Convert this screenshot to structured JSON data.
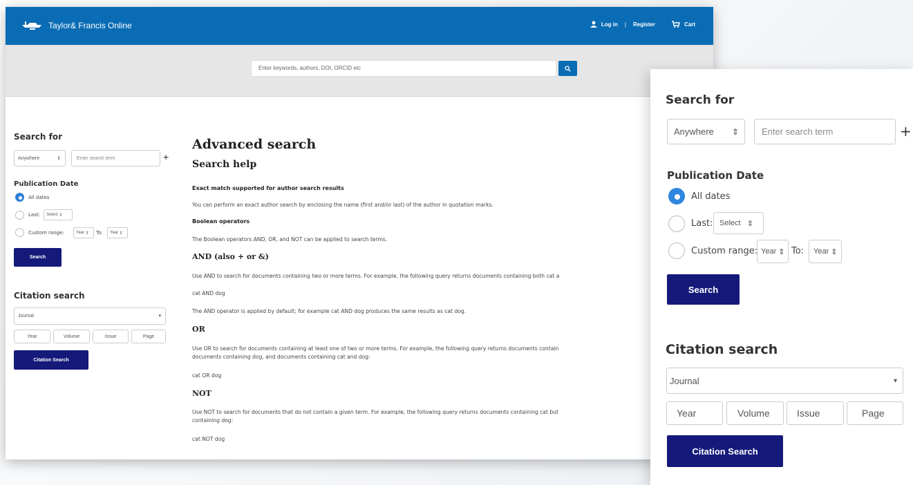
{
  "header": {
    "brand": "Taylor& Francis Online",
    "login": "Log in",
    "separator": "|",
    "register": "Register",
    "cart": "Cart",
    "search_placeholder": "Enter keywords, authors, DOI, ORCID etc",
    "brand_color": "#0a6cb4"
  },
  "sidebar": {
    "search_for_title": "Search for",
    "field_select": "Anywhere",
    "term_placeholder": "Enter search term",
    "add_symbol": "+",
    "pubdate_title": "Publication Date",
    "all_dates": "All dates",
    "last_label": "Last:",
    "last_select": "Select",
    "custom_range": "Custom range:",
    "year_from": "Year",
    "to_label": "To:",
    "year_to": "Year",
    "search_button": "Search",
    "citation_title": "Citation search",
    "journal_select": "Journal",
    "year_ph": "Year",
    "volume_ph": "Volume",
    "issue_ph": "Issue",
    "page_ph": "Page",
    "citation_button": "Citation Search",
    "button_color": "#14197a",
    "radio_color": "#2f7fd6"
  },
  "main": {
    "title": "Advanced search",
    "help_title": "Search help",
    "exact_heading": "Exact match supported for author search results",
    "exact_text": "You can perform an exact author search by enclosing the name (first and/or last) of the author in quotation marks.",
    "boolean_heading": "Boolean operators",
    "boolean_text": "The Boolean operators AND, OR, and NOT can be applied to search terms.",
    "and_heading": "AND (also + or &)",
    "and_text": "Use AND to search for documents containing two or more terms. For example, the following query returns documents containing both cat a",
    "and_example": "cat AND dog",
    "and_default": "The AND operator is applied by default; for example cat AND dog produces the same results as cat dog.",
    "or_heading": "OR",
    "or_text_1": "Use OR to search for documents containing at least one of two or more terms. For example, the following query returns documents contain",
    "or_text_2": "documents containing dog, and documents containing cat and dog:",
    "or_example": "cat OR dog",
    "not_heading": "NOT",
    "not_text_1": "Use NOT to search for documents that do not contain a given term. For example, the following query returns documents containing cat but",
    "not_text_2": "containing dog:",
    "not_example": "cat NOT dog"
  }
}
